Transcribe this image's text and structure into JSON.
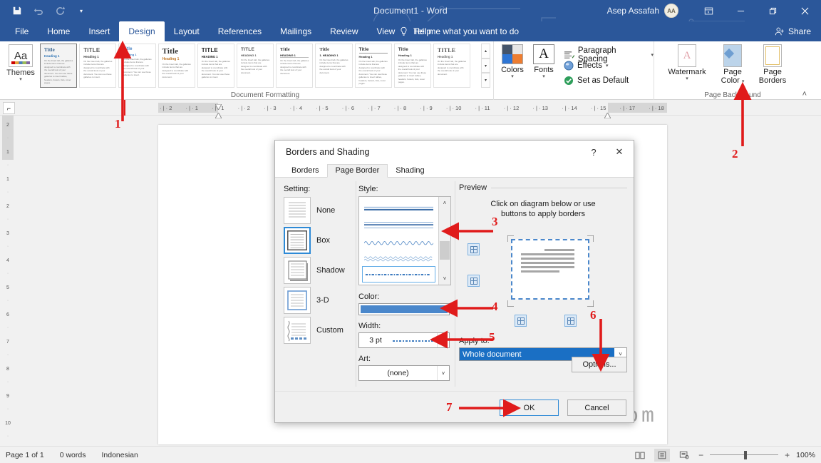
{
  "titlebar": {
    "document_title": "Document1  -  Word",
    "account_name": "Asep Assafah",
    "avatar_initials": "AA",
    "qat": [
      {
        "name": "save-icon",
        "glyph": "💾"
      },
      {
        "name": "undo-icon",
        "glyph": "↶"
      },
      {
        "name": "redo-icon",
        "glyph": "↻"
      },
      {
        "name": "customize-qat-icon",
        "glyph": "▾"
      }
    ],
    "window_controls": [
      {
        "name": "ribbon-display-options",
        "glyph": "⬚"
      },
      {
        "name": "minimize",
        "glyph": "—"
      },
      {
        "name": "restore",
        "glyph": "❐"
      },
      {
        "name": "close",
        "glyph": "✕"
      }
    ]
  },
  "tabs": [
    {
      "label": "File",
      "active": false
    },
    {
      "label": "Home",
      "active": false
    },
    {
      "label": "Insert",
      "active": false
    },
    {
      "label": "Design",
      "active": true
    },
    {
      "label": "Layout",
      "active": false
    },
    {
      "label": "References",
      "active": false
    },
    {
      "label": "Mailings",
      "active": false
    },
    {
      "label": "Review",
      "active": false
    },
    {
      "label": "View",
      "active": false
    },
    {
      "label": "Help",
      "active": false
    }
  ],
  "tellme": {
    "label": "Tell me what you want to do",
    "icon": "lightbulb-icon"
  },
  "share": {
    "label": "Share",
    "icon": "share-person-icon"
  },
  "ribbon": {
    "themes": {
      "label": "Themes",
      "icon_text": "Aa"
    },
    "gallery_group_label": "Document Formatting",
    "gallery": [
      {
        "title": "Title",
        "heading": "Heading 1",
        "body": "On the Insert tab, the galleries include items that are designed to coordinate with the overall look of your document. You can use these galleries to insert tables, headers, footers, lists, cover pages.",
        "style": "serif-blue",
        "selected": true
      },
      {
        "title": "TITLE",
        "heading": "Heading 1",
        "body": "On the Insert tab, the galleries include items that are designed to coordinate with the overall look of your document. You can use these galleries to insert.",
        "style": "caps-gray",
        "selected": false
      },
      {
        "title": "Title",
        "heading": "Heading 1",
        "body": "On the Insert tab, the galleries include items that are designed to coordinate with the overall look of your document. You can use these galleries to insert.",
        "style": "blue-small",
        "selected": false
      },
      {
        "title": "Title",
        "heading": "Heading 1",
        "body": "On the Insert tab, the galleries include items that are designed to coordinate with the overall look of your document.",
        "style": "large-serif",
        "selected": false
      },
      {
        "title": "TITLE",
        "heading": "HEADING 1",
        "body": "On the Insert tab, the galleries include items that are designed to coordinate with the overall look of your document. You can use these galleries to insert.",
        "style": "caps-bold",
        "selected": false
      },
      {
        "title": "TITLE",
        "heading": "HEADING 1",
        "body": "On the Insert tab, the galleries include items that are designed to coordinate with the overall look of your document.",
        "style": "caps-thin",
        "selected": false
      },
      {
        "title": "Title",
        "heading": "HEADING 1",
        "body": "On the Insert tab, the galleries include items that are designed to coordinate with the overall look of your document.",
        "style": "underline",
        "selected": false
      },
      {
        "title": "Title",
        "heading": "1. HEADING 1",
        "body": "On the Insert tab, the galleries include items that are designed to coordinate with the overall look of your document.",
        "style": "numbered",
        "selected": false
      },
      {
        "title": "Title",
        "heading": "Heading 1",
        "body": "On the Insert tab, the galleries include items that are designed to coordinate with the overall look of your document. You can use these galleries to insert tables, headers, footers, lists, cover pages.",
        "style": "rule",
        "selected": false
      },
      {
        "title": "Title",
        "heading": "Heading 1",
        "body": "On the Insert tab, the galleries include items that are designed to coordinate with the overall look of your document. You can use these galleries to insert tables, headers, footers, lists, cover pages.",
        "style": "plain",
        "selected": false
      },
      {
        "title": "TITLE",
        "heading": "Heading 1",
        "body": "On the Insert tab, the galleries include items that are designed to coordinate with the overall look of your document.",
        "style": "wide-caps",
        "selected": false
      }
    ],
    "colors": {
      "label": "Colors",
      "icon": "theme-colors-icon"
    },
    "fonts": {
      "label": "Fonts",
      "icon": "theme-fonts-icon"
    },
    "paragraph_spacing": {
      "label": "Paragraph Spacing",
      "icon": "paragraph-spacing-icon"
    },
    "effects": {
      "label": "Effects",
      "icon": "effects-icon"
    },
    "set_as_default": {
      "label": "Set as Default",
      "icon": "set-default-icon"
    },
    "page_background_label": "Page Background",
    "watermark": {
      "label": "Watermark",
      "icon": "watermark-icon"
    },
    "page_color": {
      "label": "Page\nColor",
      "line1": "Page",
      "line2": "Color",
      "icon": "page-color-icon"
    },
    "page_borders": {
      "label": "Page\nBorders",
      "line1": "Page",
      "line2": "Borders",
      "icon": "page-borders-icon"
    }
  },
  "ruler": {
    "horizontal_ticks": [
      "2",
      "1",
      "1",
      "2",
      "3",
      "4",
      "5",
      "6",
      "7",
      "8",
      "9",
      "10",
      "11",
      "12",
      "13",
      "14",
      "15",
      "17",
      "18"
    ],
    "vertical_ticks": [
      "2",
      "1",
      "1",
      "2",
      "3",
      "4",
      "5",
      "6",
      "7",
      "8",
      "9",
      "10"
    ]
  },
  "document": {
    "watermark_text": "Asifah.com"
  },
  "dialog": {
    "title": "Borders and Shading",
    "help_glyph": "?",
    "close_glyph": "✕",
    "tabs": [
      {
        "label": "Borders",
        "selected": false
      },
      {
        "label": "Page Border",
        "selected": true
      },
      {
        "label": "Shading",
        "selected": false
      }
    ],
    "setting": {
      "label": "Setting:",
      "options": [
        {
          "label": "None",
          "selected": false
        },
        {
          "label": "Box",
          "selected": true
        },
        {
          "label": "Shadow",
          "selected": false
        },
        {
          "label": "3-D",
          "selected": false
        },
        {
          "label": "Custom",
          "selected": false
        }
      ]
    },
    "style": {
      "label": "Style:",
      "options": [
        "double-line-thick",
        "triple-line",
        "wavy-single",
        "wavy-double",
        "dash-dot-fancy"
      ],
      "selected_index": 4
    },
    "color": {
      "label": "Color:",
      "value_hex": "#4a87cb"
    },
    "width": {
      "label": "Width:",
      "value": "3 pt"
    },
    "art": {
      "label": "Art:",
      "value": "(none)"
    },
    "preview": {
      "label": "Preview",
      "hint_line1": "Click on diagram below or use",
      "hint_line2": "buttons to apply borders"
    },
    "apply_to": {
      "label": "Apply to:",
      "value": "Whole document"
    },
    "options_button": "Options...",
    "ok_button": "OK",
    "cancel_button": "Cancel"
  },
  "annotations": [
    {
      "number": "1",
      "target": "design-tab"
    },
    {
      "number": "2",
      "target": "page-borders-button"
    },
    {
      "number": "3",
      "target": "style-list"
    },
    {
      "number": "4",
      "target": "color-swatch"
    },
    {
      "number": "5",
      "target": "width-combo"
    },
    {
      "number": "6",
      "target": "apply-to-combo"
    },
    {
      "number": "7",
      "target": "ok-button"
    }
  ],
  "status": {
    "page": "Page 1 of 1",
    "words": "0 words",
    "language": "Indonesian",
    "zoom": "100%",
    "views": [
      {
        "name": "read-mode-icon",
        "active": false
      },
      {
        "name": "print-layout-icon",
        "active": true
      },
      {
        "name": "web-layout-icon",
        "active": false
      }
    ],
    "zoom_out": "−",
    "zoom_in": "+"
  }
}
